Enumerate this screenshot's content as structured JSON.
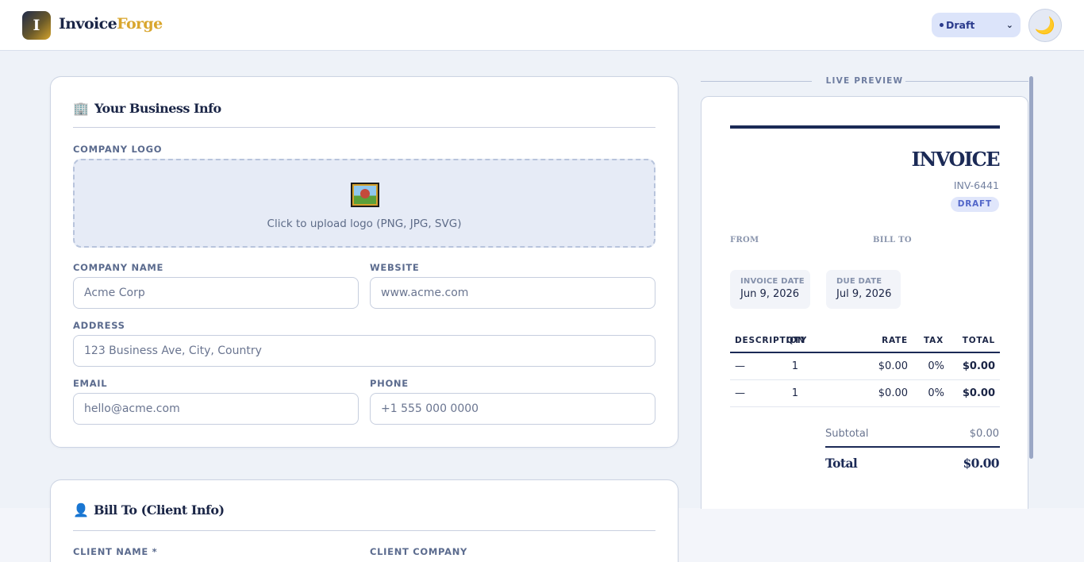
{
  "header": {
    "logo_letter": "I",
    "brand_part1": "Invoice",
    "brand_part2": "Forge",
    "status_value": "Draft",
    "theme_icon": "🌙"
  },
  "business": {
    "title": "Your Business Info",
    "title_icon": "🏢",
    "logo_label": "COMPANY LOGO",
    "upload_text": "Click to upload logo (PNG, JPG, SVG)",
    "company_name_label": "COMPANY NAME",
    "company_name_placeholder": "Acme Corp",
    "website_label": "WEBSITE",
    "website_placeholder": "www.acme.com",
    "address_label": "ADDRESS",
    "address_placeholder": "123 Business Ave, City, Country",
    "email_label": "EMAIL",
    "email_placeholder": "hello@acme.com",
    "phone_label": "PHONE",
    "phone_placeholder": "+1 555 000 0000"
  },
  "client": {
    "title": "Bill To (Client Info)",
    "title_icon": "👤",
    "client_name_label": "CLIENT NAME *",
    "client_company_label": "CLIENT COMPANY"
  },
  "preview": {
    "heading": "LIVE PREVIEW",
    "invoice_title": "INVOICE",
    "invoice_number": "INV-6441",
    "status_badge": "DRAFT",
    "from_label": "FROM",
    "bill_to_label": "BILL TO",
    "invoice_date_label": "INVOICE DATE",
    "invoice_date": "Jun 9, 2026",
    "due_date_label": "DUE DATE",
    "due_date": "Jul 9, 2026",
    "columns": {
      "description": "DESCRIPTION",
      "qty": "QTY",
      "rate": "RATE",
      "tax": "TAX",
      "total": "TOTAL"
    },
    "line_items": [
      {
        "description": "—",
        "qty": "1",
        "rate": "$0.00",
        "tax": "0%",
        "total": "$0.00"
      },
      {
        "description": "—",
        "qty": "1",
        "rate": "$0.00",
        "tax": "0%",
        "total": "$0.00"
      }
    ],
    "subtotal_label": "Subtotal",
    "subtotal_value": "$0.00",
    "total_label": "Total",
    "total_value": "$0.00"
  }
}
